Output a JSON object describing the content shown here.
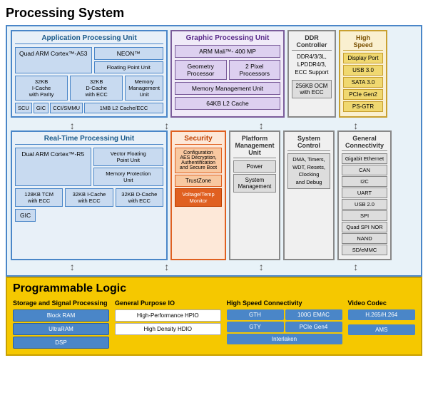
{
  "title": "Processing System",
  "apu": {
    "title": "Application Processing Unit",
    "arm": "Quad ARM Cortex™-A53",
    "neon": "NEON™",
    "fpu": "Floating Point Unit",
    "icache": "32KB\nI-Cache\nwith Parity",
    "dcache": "32KB\nD-Cache\nwith ECC",
    "mmu": "Memory\nManagement\nUnit",
    "scu": "SCU",
    "gic": "GIC",
    "cci": "CCI/SMMU",
    "l2": "1MB L2 Cache/ECC"
  },
  "gpu": {
    "title": "Graphic Processing Unit",
    "mali": "ARM Mali™- 400 MP",
    "geom": "Geometry\nProcessor",
    "pixel": "2 Pixel\nProcessors",
    "mmu": "Memory Management Unit",
    "l2": "64KB L2 Cache"
  },
  "ddr": {
    "title": "DDR\nController",
    "content": "DDR4/3/3L,\nLPDDR4/3,\nECC Support",
    "ocm": "256KB OCM\nwith ECC"
  },
  "hs": {
    "title": "High\nSpeed",
    "items": [
      "Display Port",
      "USB 3.0",
      "SATA 3.0",
      "PCIe Gen2",
      "PS-GTR"
    ]
  },
  "rpu": {
    "title": "Real-Time Processing Unit",
    "arm": "Dual ARM Cortex™-R5",
    "vfp": "Vector Floating\nPoint Unit",
    "mpu": "Memory Protection\nUnit",
    "tcm": "128KB TCM\nwith ECC",
    "icache": "32KB I-Cache\nwith ECC",
    "dcache": "32KB D-Cache\nwith ECC",
    "gic": "GIC"
  },
  "security": {
    "title": "Security",
    "aes": "Configuration\nAES Decryption,\nAuthentification\nand Secure Boot",
    "tz": "TrustZone",
    "vt": "Voltage/Temp\nMonitor"
  },
  "pmu": {
    "title": "Platform\nManagement\nUnit",
    "power": "Power",
    "sys": "System\nManagement"
  },
  "sc": {
    "title": "System\nControl",
    "content": "DMA, Timers,\nWDT, Resets,\nClocking\nand Debug"
  },
  "gc": {
    "title": "General\nConnectivity",
    "items": [
      "Gigabit Ethernet",
      "CAN",
      "I2C",
      "UART",
      "USB 2.0",
      "SPI",
      "Quad SPI NOR",
      "NAND",
      "SD/eMMC"
    ]
  },
  "pl": {
    "title": "Programmable Logic",
    "storage": {
      "title": "Storage and Signal Processing",
      "items": [
        "Block RAM",
        "UltraRAM",
        "DSP"
      ]
    },
    "gpio": {
      "title": "General Purpose IO",
      "items": [
        "High-Performance HPIO",
        "High Density HDIO"
      ]
    },
    "hsc": {
      "title": "High Speed Connectivity",
      "items": [
        "GTH",
        "100G EMAC",
        "GTY",
        "PCIe Gen4",
        "Interlaken"
      ]
    },
    "vc": {
      "title": "Video Codec",
      "items": [
        "H.265/H.264",
        "AMS"
      ]
    }
  }
}
